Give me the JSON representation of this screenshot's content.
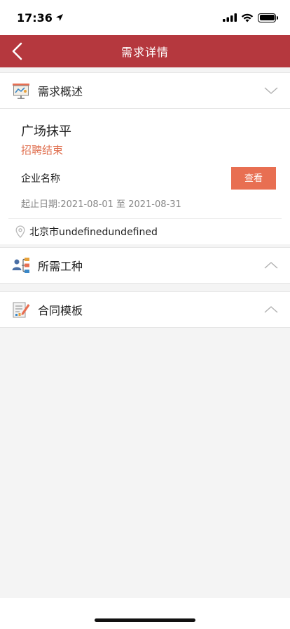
{
  "status_bar": {
    "time": "17:36"
  },
  "nav": {
    "title": "需求详情"
  },
  "overview": {
    "title": "需求概述",
    "job_name": "广场抹平",
    "status": "招聘结束",
    "company_label": "企业名称",
    "view_button": "查看",
    "date_text": "起止日期:2021-08-01 至 2021-08-31",
    "location": "北京市undefinedundefined"
  },
  "sections": {
    "work_types": "所需工种",
    "contract": "合同模板"
  },
  "colors": {
    "nav_bg": "#b5383e",
    "accent": "#e86f52",
    "status_text": "#e07050"
  }
}
